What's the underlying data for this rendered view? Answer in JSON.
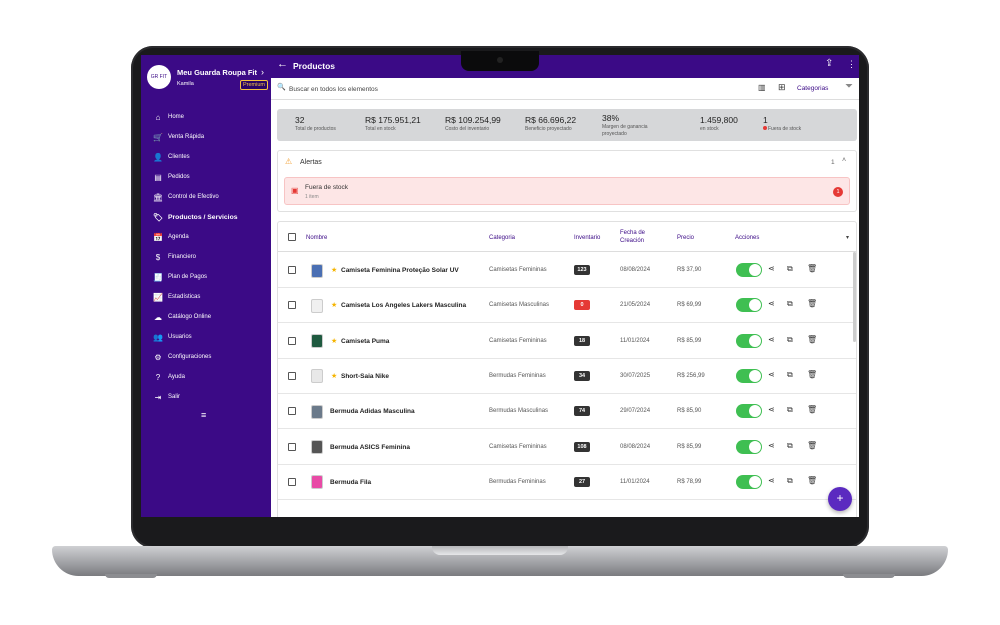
{
  "brand": {
    "name": "Meu Guarda Roupa Fit",
    "user": "Kamila",
    "plan": "Premium",
    "logo_text": "GR FIT"
  },
  "sidebar": {
    "items": [
      {
        "label": "Home",
        "icon": "home-icon",
        "glyph": "⌂"
      },
      {
        "label": "Venta Rápida",
        "icon": "cart-icon",
        "glyph": "🛒"
      },
      {
        "label": "Clientes",
        "icon": "person-icon",
        "glyph": "👤"
      },
      {
        "label": "Pedidos",
        "icon": "list-icon",
        "glyph": "▤"
      },
      {
        "label": "Control de Efectivo",
        "icon": "bank-icon",
        "glyph": "🏛"
      },
      {
        "label": "Productos / Servicios",
        "icon": "tag-icon",
        "glyph": "🏷"
      },
      {
        "label": "Agenda",
        "icon": "calendar-icon",
        "glyph": "📅"
      },
      {
        "label": "Financiero",
        "icon": "dollar-icon",
        "glyph": "$"
      },
      {
        "label": "Plan de Pagos",
        "icon": "receipt-icon",
        "glyph": "🧾"
      },
      {
        "label": "Estadísticas",
        "icon": "chart-icon",
        "glyph": "📈"
      },
      {
        "label": "Catálogo Online",
        "icon": "cloud-icon",
        "glyph": "☁"
      },
      {
        "label": "Usuarios",
        "icon": "users-icon",
        "glyph": "👥"
      },
      {
        "label": "Configuraciones",
        "icon": "gear-icon",
        "glyph": "⚙"
      },
      {
        "label": "Ayuda",
        "icon": "help-icon",
        "glyph": "?"
      },
      {
        "label": "Salir",
        "icon": "logout-icon",
        "glyph": "⇥"
      }
    ],
    "active_index": 5
  },
  "header": {
    "title": "Productos"
  },
  "search": {
    "placeholder": "Buscar en todos los elementos",
    "categories_label": "Categorias"
  },
  "stats": [
    {
      "value": "32",
      "label": "Total de productos"
    },
    {
      "value": "R$ 175.951,21",
      "label": "Total en stock"
    },
    {
      "value": "R$ 109.254,99",
      "label": "Costo del inventario"
    },
    {
      "value": "R$ 66.696,22",
      "label": "Beneficio proyectado"
    },
    {
      "value": "38%",
      "label": "Margen de ganancia",
      "label2": "proyectado"
    },
    {
      "value": "1.459,800",
      "label": "en stock"
    },
    {
      "value": "1",
      "label": "Fuera de stock"
    }
  ],
  "alerts": {
    "title": "Alertas",
    "count": "1",
    "item": {
      "title": "Fuera de stock",
      "subtitle": "1 item",
      "badge": "1"
    }
  },
  "table": {
    "headers": {
      "name": "Nombre",
      "category": "Categoria",
      "inventory": "Inventario",
      "date_line1": "Fecha de",
      "date_line2": "Creación",
      "price": "Precio",
      "actions": "Acciones"
    },
    "rows": [
      {
        "name": "Camiseta Feminina Proteção Solar UV",
        "category": "Camisetas Femininas",
        "inventory": "123",
        "date": "08/08/2024",
        "price": "R$ 37,90",
        "starred": true,
        "color": "#4a6fb3"
      },
      {
        "name": "Camiseta Los Angeles Lakers Masculina",
        "category": "Camisetas Masculinas",
        "inventory": "0",
        "date": "21/05/2024",
        "price": "R$ 69,99",
        "starred": true,
        "color": "#f0f0f0"
      },
      {
        "name": "Camiseta Puma",
        "category": "Camisetas Femininas",
        "inventory": "18",
        "date": "11/01/2024",
        "price": "R$ 85,99",
        "starred": true,
        "color": "#1f5a40"
      },
      {
        "name": "Short-Saia Nike",
        "category": "Bermudas Femininas",
        "inventory": "34",
        "date": "30/07/2025",
        "price": "R$ 256,99",
        "starred": true,
        "color": "#e8e8e8"
      },
      {
        "name": "Bermuda Adidas Masculina",
        "category": "Bermudas Masculinas",
        "inventory": "74",
        "date": "29/07/2024",
        "price": "R$ 85,90",
        "starred": false,
        "color": "#6b7a8a"
      },
      {
        "name": "Bermuda ASICS Feminina",
        "category": "Camisetas Femininas",
        "inventory": "108",
        "date": "08/08/2024",
        "price": "R$ 85,99",
        "starred": false,
        "color": "#555555"
      },
      {
        "name": "Bermuda Fila",
        "category": "Bermudas Femininas",
        "inventory": "27",
        "date": "11/01/2024",
        "price": "R$ 78,99",
        "starred": false,
        "color": "#e84aa6"
      }
    ]
  },
  "colors": {
    "primary": "#3b0a86",
    "toggle_on": "#3fbf52",
    "danger": "#e53935",
    "star": "#f5b400"
  }
}
